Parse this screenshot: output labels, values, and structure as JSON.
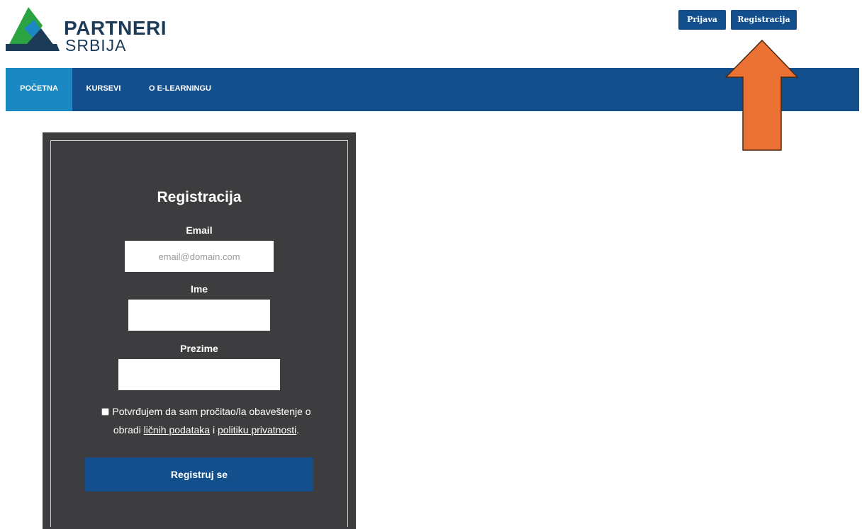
{
  "logo": {
    "line1": "PARTNERI",
    "line2": "SRBIJA"
  },
  "header": {
    "login_label": "Prijava",
    "register_label": "Registracija"
  },
  "nav": {
    "items": [
      "POČETNA",
      "KURSEVI",
      "O E-LEARNINGU"
    ],
    "active_index": 0
  },
  "form": {
    "title": "Registracija",
    "email_label": "Email",
    "email_placeholder": "email@domain.com",
    "first_name_label": "Ime",
    "last_name_label": "Prezime",
    "consent_text_1": "Potvrđujem da sam pročitao/la obaveštenje o obradi",
    "consent_link_1": "ličnih podataka",
    "consent_text_2": "i",
    "consent_link_2": "politiku privatnosti",
    "consent_text_3": ".",
    "submit_label": "Registruj se"
  },
  "colors": {
    "brand_blue": "#134f8d",
    "nav_active": "#1a88c2",
    "panel_bg": "#3d3d40",
    "arrow_fill": "#ec7134",
    "logo_green": "#2ca342",
    "logo_blue": "#1d3b57",
    "logo_teal": "#1a88c2"
  },
  "annotation": {
    "arrow": "arrow-up-icon",
    "points_to": "register-button"
  }
}
